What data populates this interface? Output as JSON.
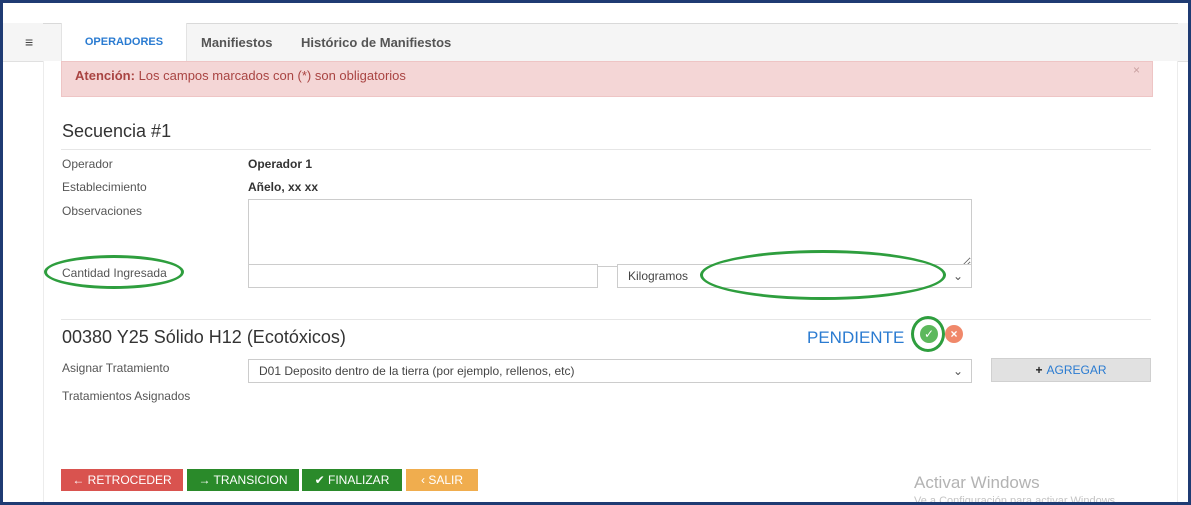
{
  "nav": {
    "menu_icon": "≡",
    "tabs": [
      {
        "label": "OPERADORES",
        "active": true
      },
      {
        "label": "Manifiestos"
      },
      {
        "label": "Histórico de Manifiestos"
      }
    ]
  },
  "alert": {
    "strong": "Atención:",
    "text": " Los campos marcados con (*) son obligatorios",
    "close": "×"
  },
  "sequence": {
    "title": "Secuencia #1",
    "operador_label": "Operador",
    "operador_value": "Operador 1",
    "establecimiento_label": "Establecimiento",
    "establecimiento_value": "Añelo, xx xx",
    "observaciones_label": "Observaciones",
    "observaciones_value": "",
    "cantidad_label": "Cantidad Ingresada",
    "cantidad_value": "",
    "unidad_selected": "Kilogramos"
  },
  "waste": {
    "title": "00380 Y25 Sólido H12 (Ecotóxicos)",
    "status": "PENDIENTE",
    "asignar_label": "Asignar Tratamiento",
    "tratamiento_selected": "D01 Deposito dentro de la tierra (por ejemplo, rellenos, etc)",
    "agregar_label": "AGREGAR",
    "asignados_label": "Tratamientos Asignados"
  },
  "actions": {
    "retroceder": "← RETROCEDER",
    "transicion": "→ TRANSICION",
    "finalizar": "✔ FINALIZAR",
    "salir": "‹ SALIR"
  },
  "watermark": {
    "line1": "Activar Windows",
    "line2": "Ve a Configuración para activar Windows."
  },
  "colors": {
    "accent": "#2a7bd1",
    "highlight": "#2e9e3e",
    "danger": "#d9534f",
    "success": "#2a8a2a",
    "warning": "#f0ad4e"
  }
}
